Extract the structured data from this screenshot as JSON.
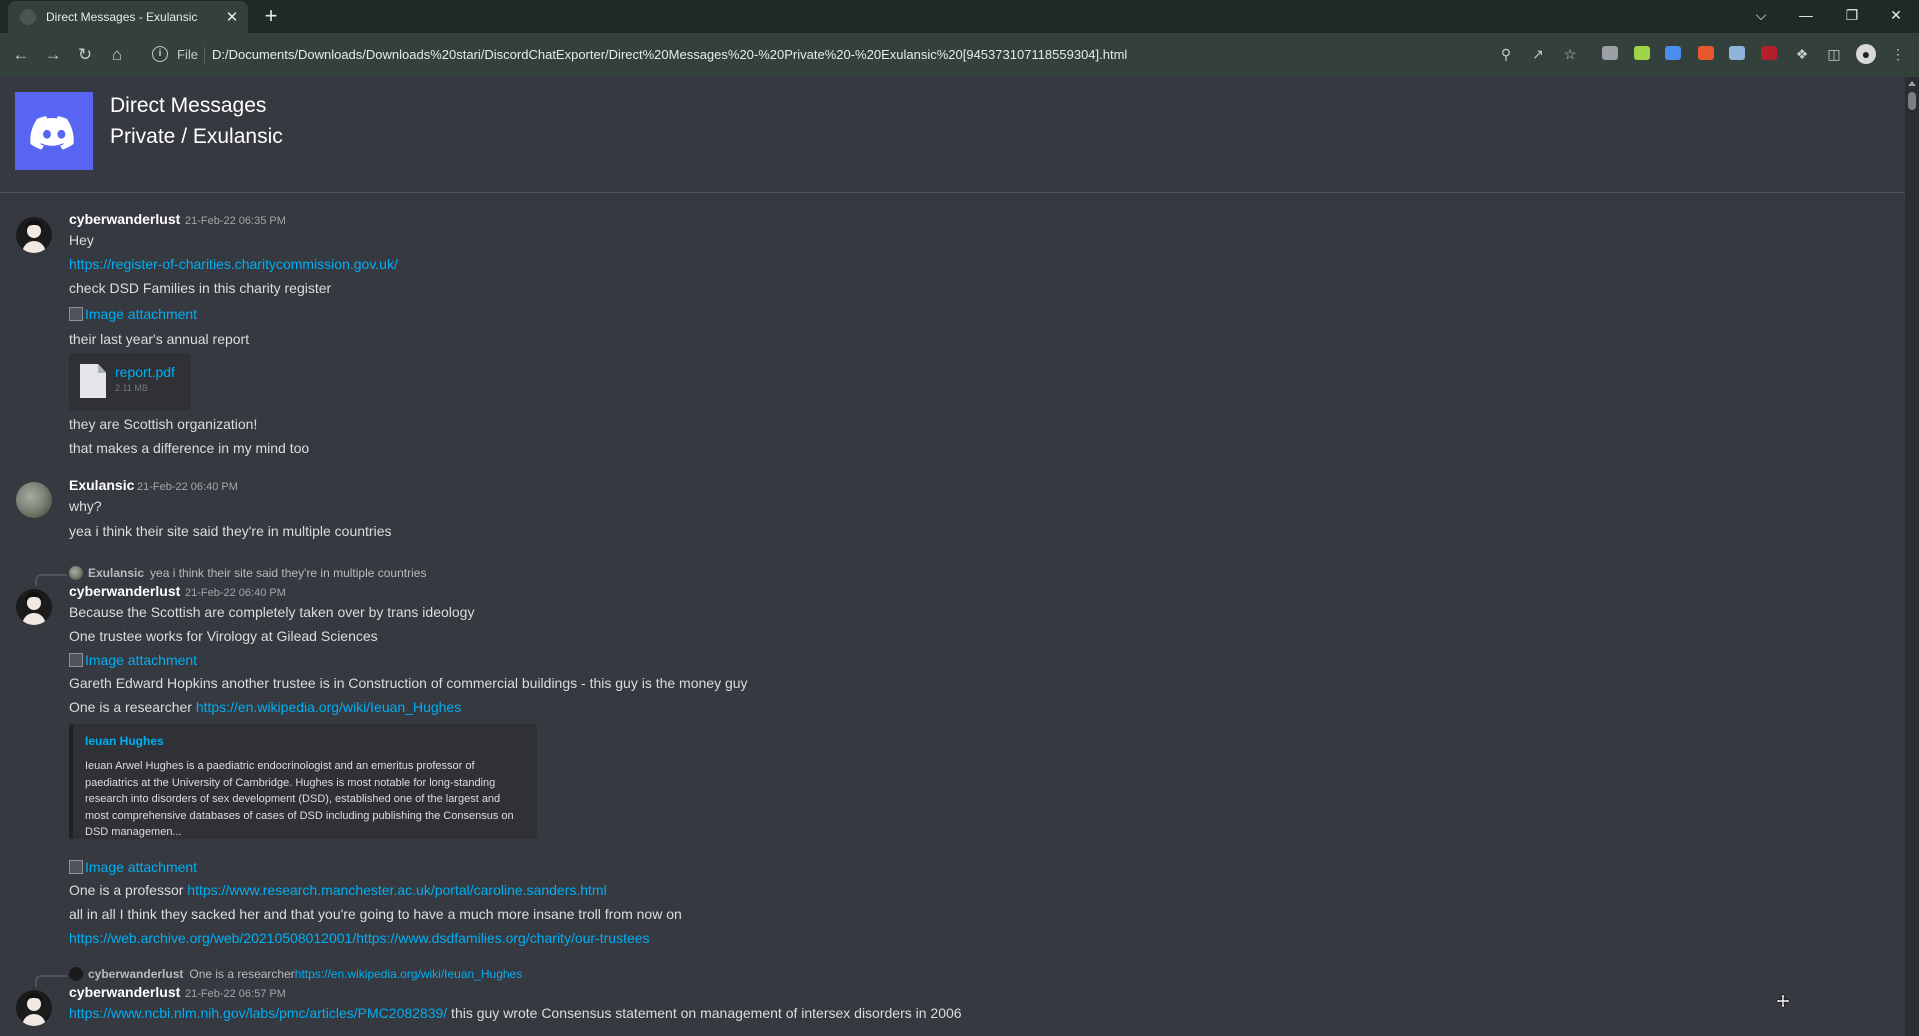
{
  "browser": {
    "tab_title": "Direct Messages - Exulansic",
    "tab_close": "✕",
    "new_tab": "+",
    "address_scheme": "File",
    "address_url": "D:/Documents/Downloads/Downloads%20stari/DiscordChatExporter/Direct%20Messages%20-%20Private%20-%20Exulansic%20[945373107118559304].html",
    "window_controls": {
      "tab_search": "⌵",
      "minimize": "—",
      "restore": "❐",
      "close": "✕"
    }
  },
  "header": {
    "guild_name": "Direct Messages",
    "channel_name": "Private / Exulansic",
    "accent": "#5865f2"
  },
  "messages": {
    "g1": {
      "author": "cyberwanderlust",
      "timestamp": "21-Feb-22 06:35 PM",
      "line1": "Hey",
      "link1": "https://register-of-charities.charitycommission.gov.uk/",
      "line2": "check DSD Families in this charity register",
      "image_alt": "Image attachment",
      "line3": "their last year's annual report",
      "file_name": "report.pdf",
      "file_size": "2.11 MB",
      "line4": "they are Scottish organization!",
      "line5": "that makes a difference in my mind too"
    },
    "g2": {
      "author": "Exulansic",
      "timestamp": "21-Feb-22 06:40 PM",
      "line1": "why?",
      "line2": "yea i think their site said they're in multiple countries"
    },
    "g3": {
      "reply_author": "Exulansic",
      "reply_text": "yea i think their site said they're in multiple countries",
      "author": "cyberwanderlust",
      "timestamp": "21-Feb-22 06:40 PM",
      "line1": "Because the Scottish are completely taken over by trans ideology",
      "line2": "One trustee works for Virology at Gilead Sciences",
      "image_alt1": "Image attachment",
      "line3": "Gareth Edward Hopkins another trustee is in Construction of commercial buildings  - this guy is the money guy",
      "line4_prefix": "One is a researcher ",
      "line4_link": "https://en.wikipedia.org/wiki/Ieuan_Hughes",
      "embed_title": "Ieuan Hughes",
      "embed_desc": "Ieuan Arwel Hughes  is a paediatric endocrinologist and an emeritus professor of paediatrics at the University of Cambridge. Hughes is most notable for long-standing research into disorders of sex development (DSD), established one of the largest and most comprehensive databases of cases of DSD including publishing the Consensus on DSD managemen...",
      "image_alt2": "Image attachment",
      "line5_prefix": "One is a professor ",
      "line5_link": "https://www.research.manchester.ac.uk/portal/caroline.sanders.html",
      "line6": "all in all I think they sacked her and that you're going to have a much more insane troll from now on",
      "link7": "https://web.archive.org/web/20210508012001/https://www.dsdfamilies.org/charity/our-trustees"
    },
    "g4": {
      "reply_author": "cyberwanderlust",
      "reply_prefix": "One is a researcher ",
      "reply_link": "https://en.wikipedia.org/wiki/Ieuan_Hughes",
      "author": "cyberwanderlust",
      "timestamp": "21-Feb-22 06:57 PM",
      "line1_link": "https://www.ncbi.nlm.nih.gov/labs/pmc/articles/PMC2082839/",
      "line1_suffix": " this guy wrote Consensus statement on management of intersex disorders in 2006"
    }
  }
}
